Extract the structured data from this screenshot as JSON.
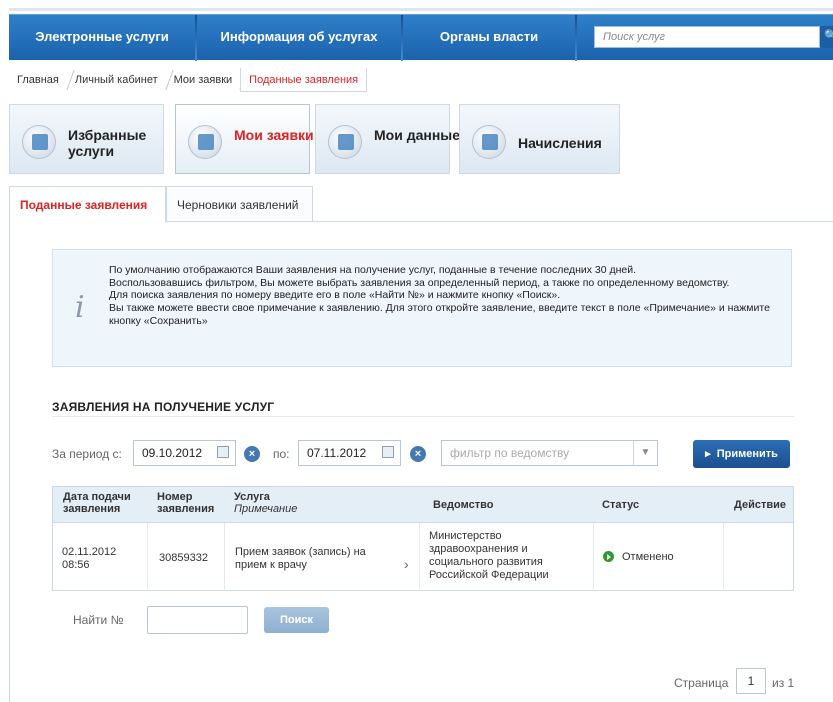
{
  "nav": {
    "items": [
      "Электронные услуги",
      "Информация об услугах",
      "Органы власти"
    ],
    "search_placeholder": "Поиск услуг",
    "search_icon": "search-icon"
  },
  "breadcrumb": [
    "Главная",
    "Личный кабинет",
    "Мои заявки",
    "Поданные заявления"
  ],
  "tiles": [
    {
      "label": "Избранные услуги",
      "icon": "favorites-icon"
    },
    {
      "label": "Мои заявки",
      "icon": "list-icon"
    },
    {
      "label": "Мои данные",
      "icon": "data-icon"
    },
    {
      "label": "Начисления",
      "icon": "accruals-icon"
    }
  ],
  "tabs": {
    "active": "Поданные заявления",
    "drafts": "Черновики заявлений"
  },
  "info": {
    "lines": [
      "По умолчанию отображаются Ваши заявления на получение услуг, поданные в течение последних 30 дней.",
      "Воспользовавшись фильтром, Вы можете выбрать заявления за определенный период, а также по определенному ведомству.",
      "Для поиска заявления по номеру введите его в поле «Найти №» и нажмите кнопку «Поиск».",
      "Вы также можете ввести свое примечание к заявлению. Для этого откройте заявление, введите текст в поле «Примечание» и нажмите кнопку «Сохранить»"
    ]
  },
  "section_title": "ЗАЯВЛЕНИЯ НА ПОЛУЧЕНИЕ УСЛУГ",
  "filter": {
    "period_from_label": "За период с:",
    "date_from": "09.10.2012",
    "to_label": "по:",
    "date_to": "07.11.2012",
    "department_placeholder": "фильтр по ведомству",
    "apply_label": "Применить"
  },
  "table": {
    "headers": {
      "date": "Дата подачи заявления",
      "number": "Номер заявления",
      "service": "Услуга",
      "note": "Примечание",
      "department": "Ведомство",
      "status": "Статус",
      "action": "Действие"
    },
    "rows": [
      {
        "date": "02.11.2012",
        "time": "08:56",
        "number": "30859332",
        "service": "Прием заявок (запись) на прием к врачу",
        "department": "Министерство здравоохранения и социального развития Российской Федерации",
        "status": "Отменено",
        "status_color": "#2e9a2e"
      }
    ]
  },
  "find": {
    "label": "Найти №",
    "button": "Поиск"
  },
  "pagination": {
    "label": "Страница",
    "current": "1",
    "of": "из 1"
  }
}
